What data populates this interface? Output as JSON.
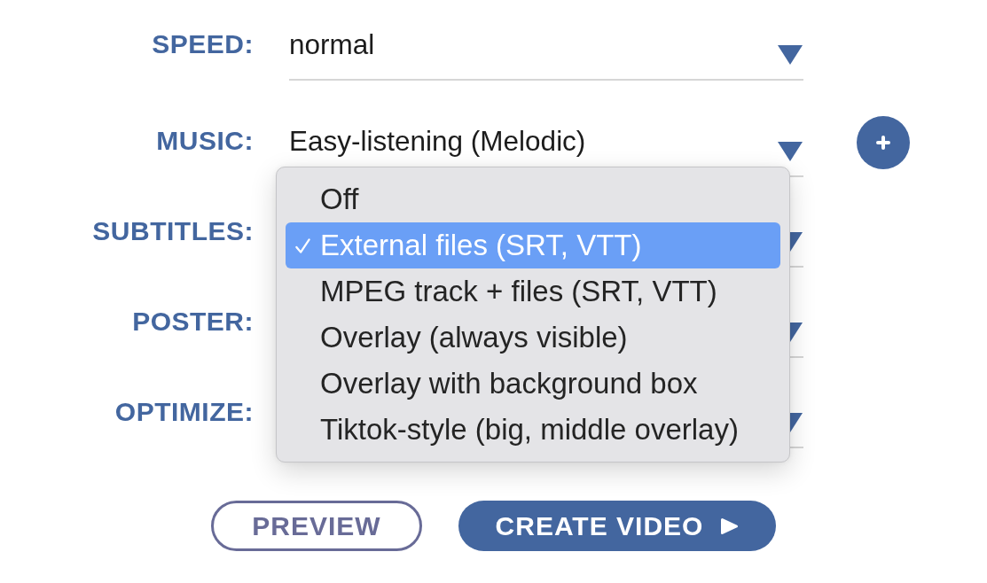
{
  "fields": [
    {
      "label": "SPEED:",
      "value": "normal",
      "add_button": false,
      "expanded": false
    },
    {
      "label": "MUSIC:",
      "value": "Easy-listening (Melodic)",
      "add_button": true,
      "expanded": false
    },
    {
      "label": "SUBTITLES:",
      "add_button": false,
      "expanded": true,
      "options": [
        {
          "label": "Off",
          "selected": false
        },
        {
          "label": "External files (SRT, VTT)",
          "selected": true
        },
        {
          "label": "MPEG track + files (SRT, VTT)",
          "selected": false
        },
        {
          "label": "Overlay (always visible)",
          "selected": false
        },
        {
          "label": "Overlay with background box",
          "selected": false
        },
        {
          "label": "Tiktok-style (big, middle overlay)",
          "selected": false
        }
      ]
    },
    {
      "label": "POSTER:",
      "add_button": false,
      "expanded": false
    },
    {
      "label": "OPTIMIZE:",
      "add_button": false,
      "expanded": false
    }
  ],
  "buttons": [
    {
      "label": "PREVIEW",
      "kind": "outline"
    },
    {
      "label": "CREATE VIDEO",
      "kind": "primary"
    }
  ]
}
